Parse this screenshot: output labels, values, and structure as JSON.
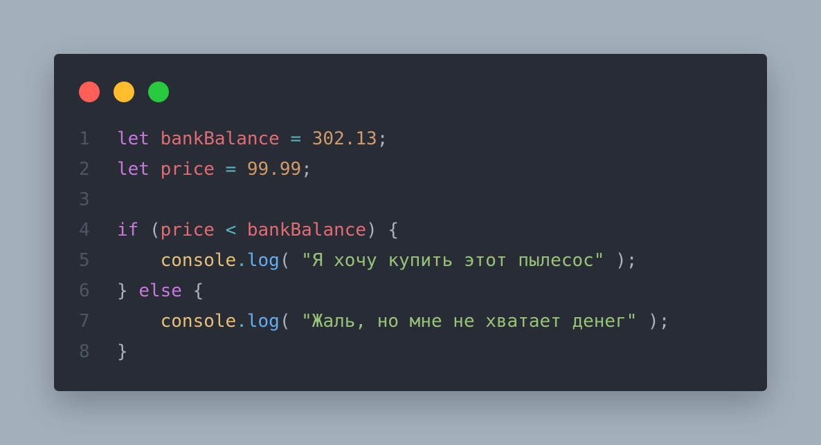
{
  "colors": {
    "page_bg": "#a5b0bd",
    "editor_bg": "#282c35",
    "line_number": "#4e5563",
    "keyword": "#c678dd",
    "variable": "#e06c75",
    "operator": "#56b6c2",
    "number": "#d19a66",
    "string": "#98c379",
    "object": "#e5c07b",
    "method": "#61afef",
    "punctuation": "#abb2bf",
    "dot_red": "#ff5f56",
    "dot_yellow": "#ffbd2e",
    "dot_green": "#27c93f"
  },
  "window_controls": [
    {
      "name": "close",
      "color": "#ff5f56"
    },
    {
      "name": "minimize",
      "color": "#ffbd2e"
    },
    {
      "name": "maximize",
      "color": "#27c93f"
    }
  ],
  "lines": [
    {
      "number": "1",
      "tokens": [
        {
          "t": "let",
          "k": "keyword"
        },
        {
          "t": " ",
          "k": "punctuation"
        },
        {
          "t": "bankBalance",
          "k": "variable"
        },
        {
          "t": " ",
          "k": "punctuation"
        },
        {
          "t": "=",
          "k": "operator"
        },
        {
          "t": " ",
          "k": "punctuation"
        },
        {
          "t": "302.13",
          "k": "number"
        },
        {
          "t": ";",
          "k": "punctuation"
        }
      ]
    },
    {
      "number": "2",
      "tokens": [
        {
          "t": "let",
          "k": "keyword"
        },
        {
          "t": " ",
          "k": "punctuation"
        },
        {
          "t": "price",
          "k": "variable"
        },
        {
          "t": " ",
          "k": "punctuation"
        },
        {
          "t": "=",
          "k": "operator"
        },
        {
          "t": " ",
          "k": "punctuation"
        },
        {
          "t": "99.99",
          "k": "number"
        },
        {
          "t": ";",
          "k": "punctuation"
        }
      ]
    },
    {
      "number": "3",
      "tokens": []
    },
    {
      "number": "4",
      "tokens": [
        {
          "t": "if",
          "k": "keyword"
        },
        {
          "t": " (",
          "k": "punctuation"
        },
        {
          "t": "price",
          "k": "variable"
        },
        {
          "t": " ",
          "k": "punctuation"
        },
        {
          "t": "<",
          "k": "operator"
        },
        {
          "t": " ",
          "k": "punctuation"
        },
        {
          "t": "bankBalance",
          "k": "variable"
        },
        {
          "t": ") {",
          "k": "punctuation"
        }
      ]
    },
    {
      "number": "5",
      "tokens": [
        {
          "t": "    ",
          "k": "punctuation"
        },
        {
          "t": "console",
          "k": "object"
        },
        {
          "t": ".",
          "k": "operator"
        },
        {
          "t": "log",
          "k": "method"
        },
        {
          "t": "( ",
          "k": "punctuation"
        },
        {
          "t": "\"Я хочу купить этот пылесос\"",
          "k": "string"
        },
        {
          "t": " );",
          "k": "punctuation"
        }
      ]
    },
    {
      "number": "6",
      "tokens": [
        {
          "t": "} ",
          "k": "punctuation"
        },
        {
          "t": "else",
          "k": "keyword"
        },
        {
          "t": " {",
          "k": "punctuation"
        }
      ]
    },
    {
      "number": "7",
      "tokens": [
        {
          "t": "    ",
          "k": "punctuation"
        },
        {
          "t": "console",
          "k": "object"
        },
        {
          "t": ".",
          "k": "operator"
        },
        {
          "t": "log",
          "k": "method"
        },
        {
          "t": "( ",
          "k": "punctuation"
        },
        {
          "t": "\"Жаль, но мне не хватает денег\"",
          "k": "string"
        },
        {
          "t": " );",
          "k": "punctuation"
        }
      ]
    },
    {
      "number": "8",
      "tokens": [
        {
          "t": "}",
          "k": "punctuation"
        }
      ]
    }
  ]
}
